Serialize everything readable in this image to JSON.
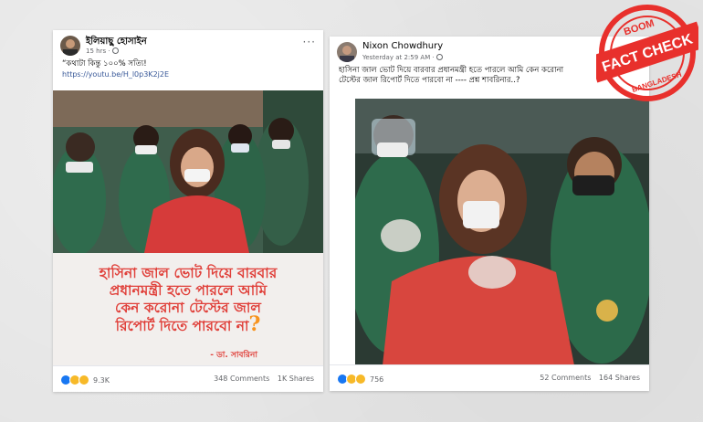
{
  "post1": {
    "author": "ইলিয়াছু হোসাইন",
    "time": "15 hrs ·",
    "more": "···",
    "caption": "“কথাটা কিন্তু ১০০% সত্যি!",
    "link": "https://youtu.be/H_l0p3K2j2E",
    "image_text": {
      "line1": "হাসিনা জাল ভোট দিয়ে বারবার",
      "line2": "প্রধানমন্ত্রী হতে পারলে আমি",
      "line3": "কেন করোনা টেস্টের জাল",
      "line4": "রিপোর্ট দিতে পারবো না",
      "qmark": "?",
      "signature": "- ডা. সাবরিনা"
    },
    "reaction_count": "9.3K",
    "comments": "348 Comments",
    "shares": "1K Shares"
  },
  "post2": {
    "author": "Nixon Chowdhury",
    "time": "Yesterday at 2:59 AM ·",
    "more": "···",
    "caption": "হাসিনা জাল ভোট দিয়ে বারবার প্রধানমন্ত্রী হতে পারলে আমি কেন করোনা টেস্টের জাল রিপোর্ট দিতে পারবো না ---- প্রশ্ন শাবরিনার..?",
    "reaction_count": "756",
    "comments": "52 Comments",
    "shares": "164 Shares"
  },
  "badge": {
    "top": "BOOM",
    "main": "FACT CHECK",
    "bottom": "BANGLADESH",
    "color": "#e8302c"
  }
}
